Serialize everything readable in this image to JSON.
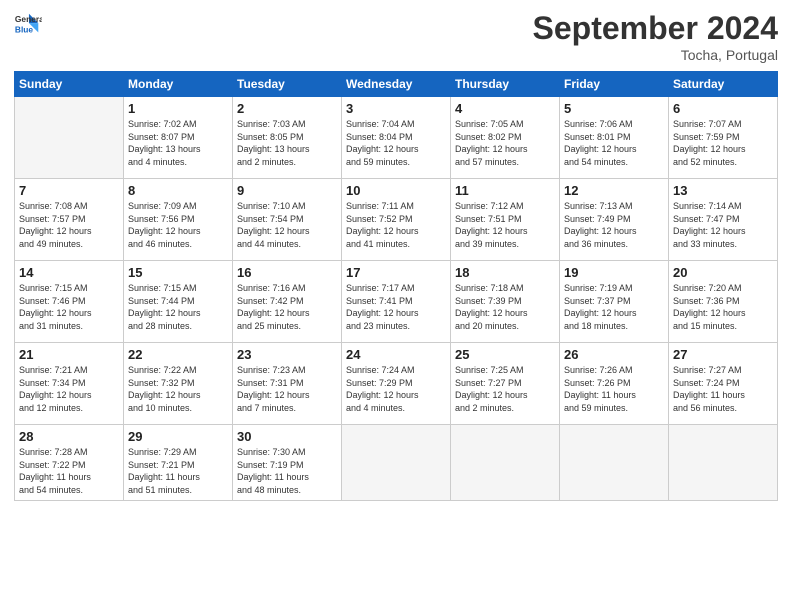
{
  "logo": {
    "line1": "General",
    "line2": "Blue"
  },
  "title": "September 2024",
  "location": "Tocha, Portugal",
  "weekdays": [
    "Sunday",
    "Monday",
    "Tuesday",
    "Wednesday",
    "Thursday",
    "Friday",
    "Saturday"
  ],
  "days": [
    {
      "num": "",
      "info": "",
      "empty": true
    },
    {
      "num": "1",
      "info": "Sunrise: 7:02 AM\nSunset: 8:07 PM\nDaylight: 13 hours\nand 4 minutes."
    },
    {
      "num": "2",
      "info": "Sunrise: 7:03 AM\nSunset: 8:05 PM\nDaylight: 13 hours\nand 2 minutes."
    },
    {
      "num": "3",
      "info": "Sunrise: 7:04 AM\nSunset: 8:04 PM\nDaylight: 12 hours\nand 59 minutes."
    },
    {
      "num": "4",
      "info": "Sunrise: 7:05 AM\nSunset: 8:02 PM\nDaylight: 12 hours\nand 57 minutes."
    },
    {
      "num": "5",
      "info": "Sunrise: 7:06 AM\nSunset: 8:01 PM\nDaylight: 12 hours\nand 54 minutes."
    },
    {
      "num": "6",
      "info": "Sunrise: 7:07 AM\nSunset: 7:59 PM\nDaylight: 12 hours\nand 52 minutes."
    },
    {
      "num": "7",
      "info": "Sunrise: 7:08 AM\nSunset: 7:57 PM\nDaylight: 12 hours\nand 49 minutes."
    },
    {
      "num": "8",
      "info": "Sunrise: 7:09 AM\nSunset: 7:56 PM\nDaylight: 12 hours\nand 46 minutes."
    },
    {
      "num": "9",
      "info": "Sunrise: 7:10 AM\nSunset: 7:54 PM\nDaylight: 12 hours\nand 44 minutes."
    },
    {
      "num": "10",
      "info": "Sunrise: 7:11 AM\nSunset: 7:52 PM\nDaylight: 12 hours\nand 41 minutes."
    },
    {
      "num": "11",
      "info": "Sunrise: 7:12 AM\nSunset: 7:51 PM\nDaylight: 12 hours\nand 39 minutes."
    },
    {
      "num": "12",
      "info": "Sunrise: 7:13 AM\nSunset: 7:49 PM\nDaylight: 12 hours\nand 36 minutes."
    },
    {
      "num": "13",
      "info": "Sunrise: 7:14 AM\nSunset: 7:47 PM\nDaylight: 12 hours\nand 33 minutes."
    },
    {
      "num": "14",
      "info": "Sunrise: 7:15 AM\nSunset: 7:46 PM\nDaylight: 12 hours\nand 31 minutes."
    },
    {
      "num": "15",
      "info": "Sunrise: 7:15 AM\nSunset: 7:44 PM\nDaylight: 12 hours\nand 28 minutes."
    },
    {
      "num": "16",
      "info": "Sunrise: 7:16 AM\nSunset: 7:42 PM\nDaylight: 12 hours\nand 25 minutes."
    },
    {
      "num": "17",
      "info": "Sunrise: 7:17 AM\nSunset: 7:41 PM\nDaylight: 12 hours\nand 23 minutes."
    },
    {
      "num": "18",
      "info": "Sunrise: 7:18 AM\nSunset: 7:39 PM\nDaylight: 12 hours\nand 20 minutes."
    },
    {
      "num": "19",
      "info": "Sunrise: 7:19 AM\nSunset: 7:37 PM\nDaylight: 12 hours\nand 18 minutes."
    },
    {
      "num": "20",
      "info": "Sunrise: 7:20 AM\nSunset: 7:36 PM\nDaylight: 12 hours\nand 15 minutes."
    },
    {
      "num": "21",
      "info": "Sunrise: 7:21 AM\nSunset: 7:34 PM\nDaylight: 12 hours\nand 12 minutes."
    },
    {
      "num": "22",
      "info": "Sunrise: 7:22 AM\nSunset: 7:32 PM\nDaylight: 12 hours\nand 10 minutes."
    },
    {
      "num": "23",
      "info": "Sunrise: 7:23 AM\nSunset: 7:31 PM\nDaylight: 12 hours\nand 7 minutes."
    },
    {
      "num": "24",
      "info": "Sunrise: 7:24 AM\nSunset: 7:29 PM\nDaylight: 12 hours\nand 4 minutes."
    },
    {
      "num": "25",
      "info": "Sunrise: 7:25 AM\nSunset: 7:27 PM\nDaylight: 12 hours\nand 2 minutes."
    },
    {
      "num": "26",
      "info": "Sunrise: 7:26 AM\nSunset: 7:26 PM\nDaylight: 11 hours\nand 59 minutes."
    },
    {
      "num": "27",
      "info": "Sunrise: 7:27 AM\nSunset: 7:24 PM\nDaylight: 11 hours\nand 56 minutes."
    },
    {
      "num": "28",
      "info": "Sunrise: 7:28 AM\nSunset: 7:22 PM\nDaylight: 11 hours\nand 54 minutes."
    },
    {
      "num": "29",
      "info": "Sunrise: 7:29 AM\nSunset: 7:21 PM\nDaylight: 11 hours\nand 51 minutes."
    },
    {
      "num": "30",
      "info": "Sunrise: 7:30 AM\nSunset: 7:19 PM\nDaylight: 11 hours\nand 48 minutes."
    },
    {
      "num": "",
      "info": "",
      "empty": true
    },
    {
      "num": "",
      "info": "",
      "empty": true
    },
    {
      "num": "",
      "info": "",
      "empty": true
    },
    {
      "num": "",
      "info": "",
      "empty": true
    }
  ]
}
